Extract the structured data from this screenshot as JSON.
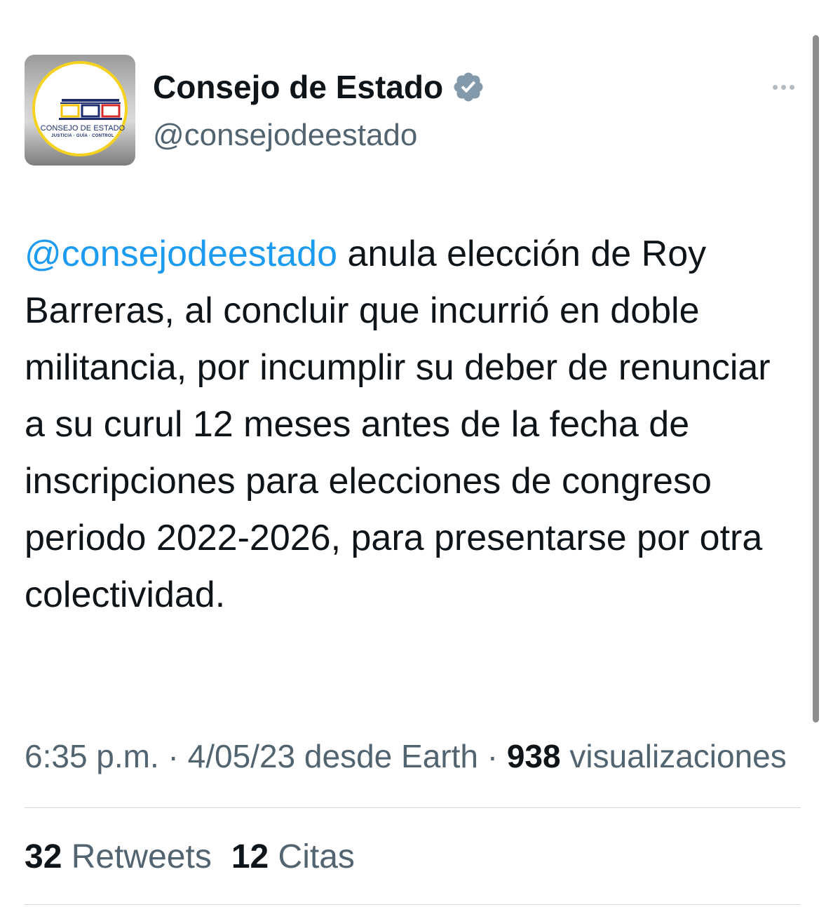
{
  "tweet": {
    "author": {
      "display_name": "Consejo de Estado",
      "handle": "@consejodeestado",
      "verified_icon": "verified-badge-icon",
      "avatar": {
        "logo_title": "CONSEJO DE ESTADO",
        "logo_subtitle": "JUSTICIA · GUÍA · CONTROL"
      }
    },
    "more_icon": "more-options-icon",
    "text": {
      "mention": "@consejodeestado",
      "body": " anula elección de Roy Barreras, al concluir que incurrió en doble militancia, por incumplir su deber de renunciar a su curul 12 meses antes de la fecha de inscripciones para elecciones de congreso periodo 2022-2026, para presentarse por otra colectividad."
    },
    "meta": {
      "timestamp": "6:35 p.m. · 4/05/23 desde Earth · ",
      "views_count": "938",
      "views_label": " visualizaciones"
    },
    "stats": {
      "retweets_count": "32",
      "retweets_label": " Retweets",
      "quotes_count": "12",
      "quotes_label": " Citas"
    }
  },
  "colors": {
    "text": "#0f1419",
    "secondary": "#536471",
    "link": "#1d9bf0",
    "verified_badge": "#829aab",
    "divider": "#cfd9de"
  }
}
